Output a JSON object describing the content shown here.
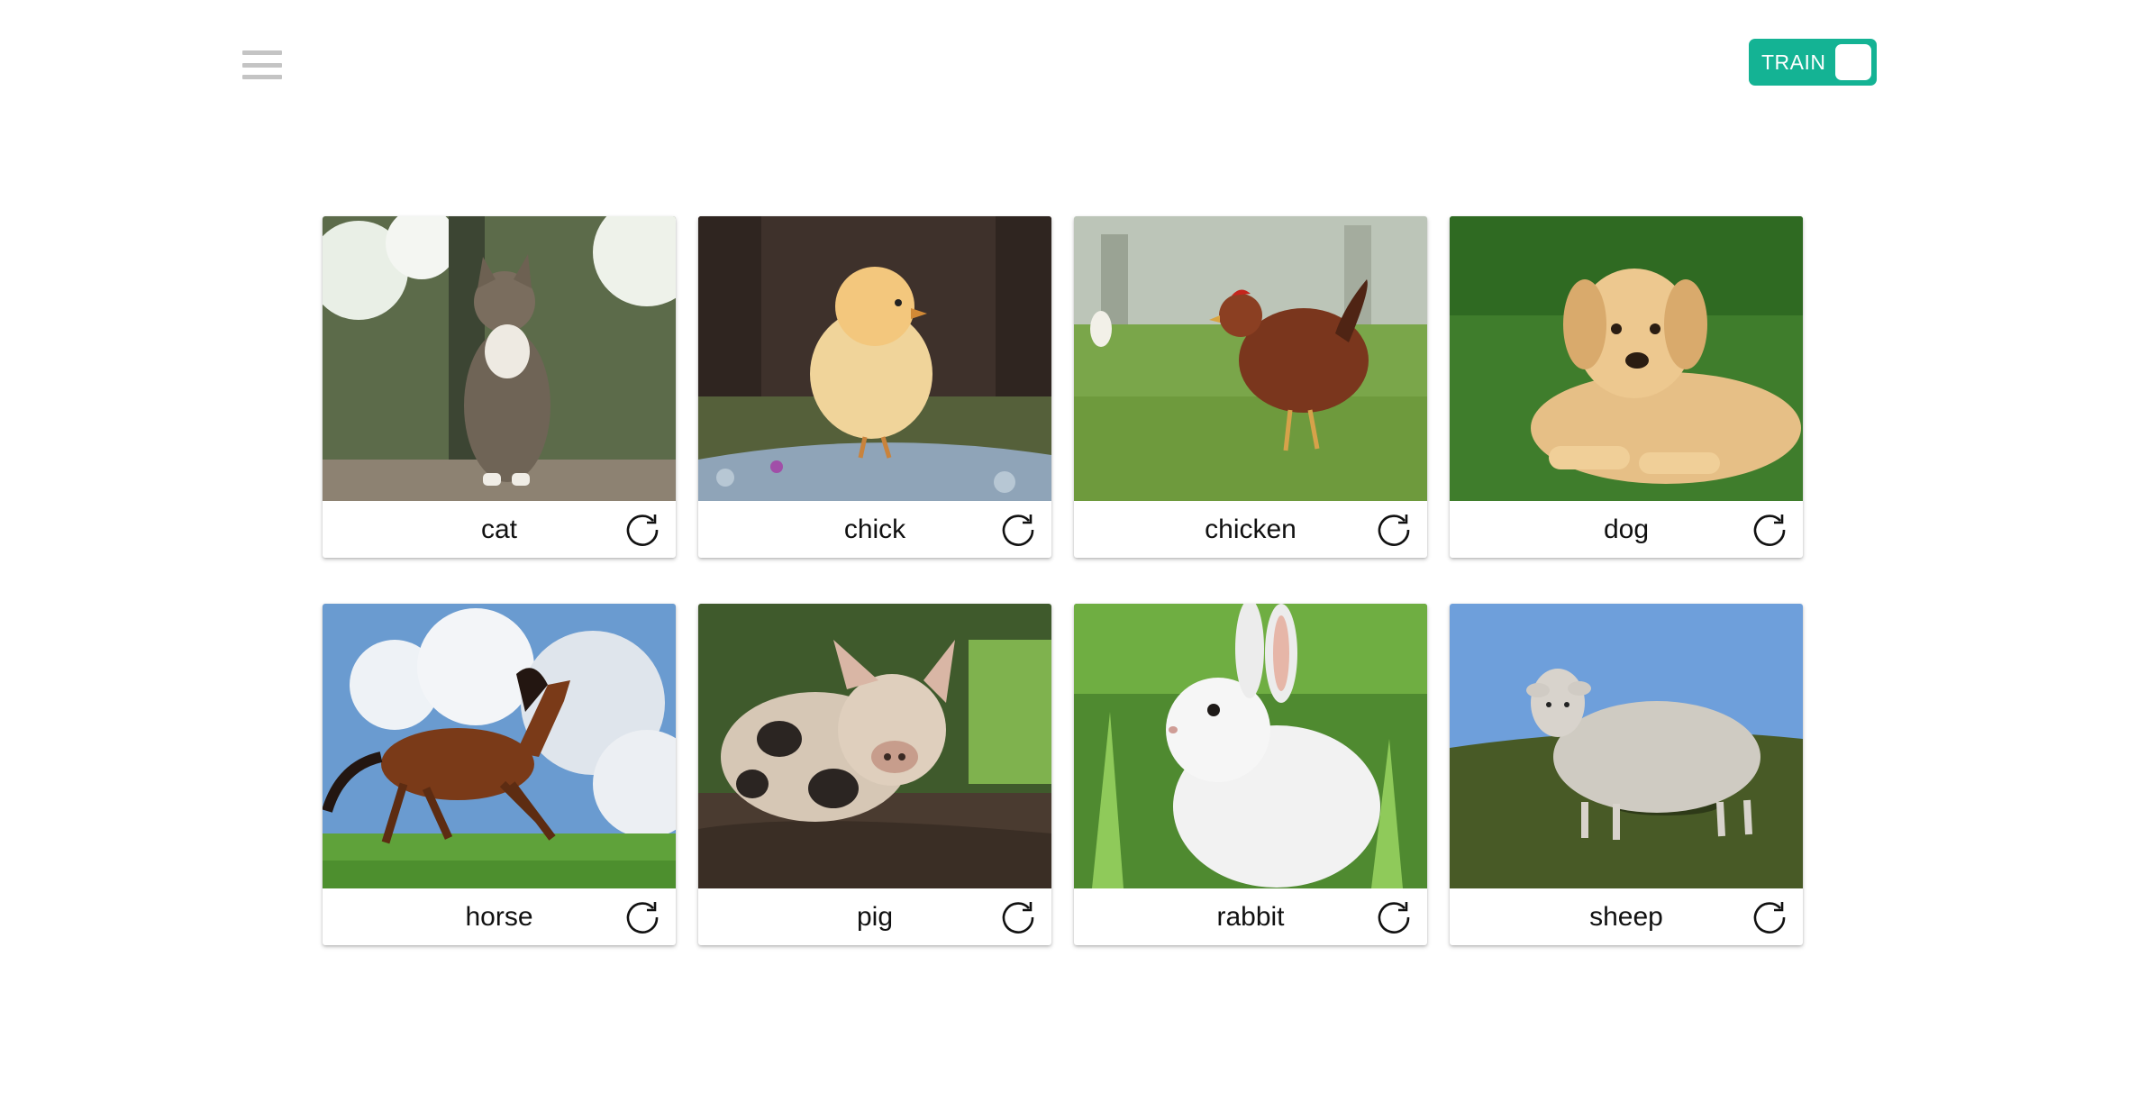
{
  "header": {
    "menu_icon": "hamburger-menu-icon",
    "train_toggle": {
      "label": "TRAIN",
      "color": "#14b394",
      "state": "on"
    }
  },
  "cards": [
    {
      "label": "cat",
      "icon": "refresh-icon"
    },
    {
      "label": "chick",
      "icon": "refresh-icon"
    },
    {
      "label": "chicken",
      "icon": "refresh-icon"
    },
    {
      "label": "dog",
      "icon": "refresh-icon"
    },
    {
      "label": "horse",
      "icon": "refresh-icon"
    },
    {
      "label": "pig",
      "icon": "refresh-icon"
    },
    {
      "label": "rabbit",
      "icon": "refresh-icon"
    },
    {
      "label": "sheep",
      "icon": "refresh-icon"
    }
  ]
}
